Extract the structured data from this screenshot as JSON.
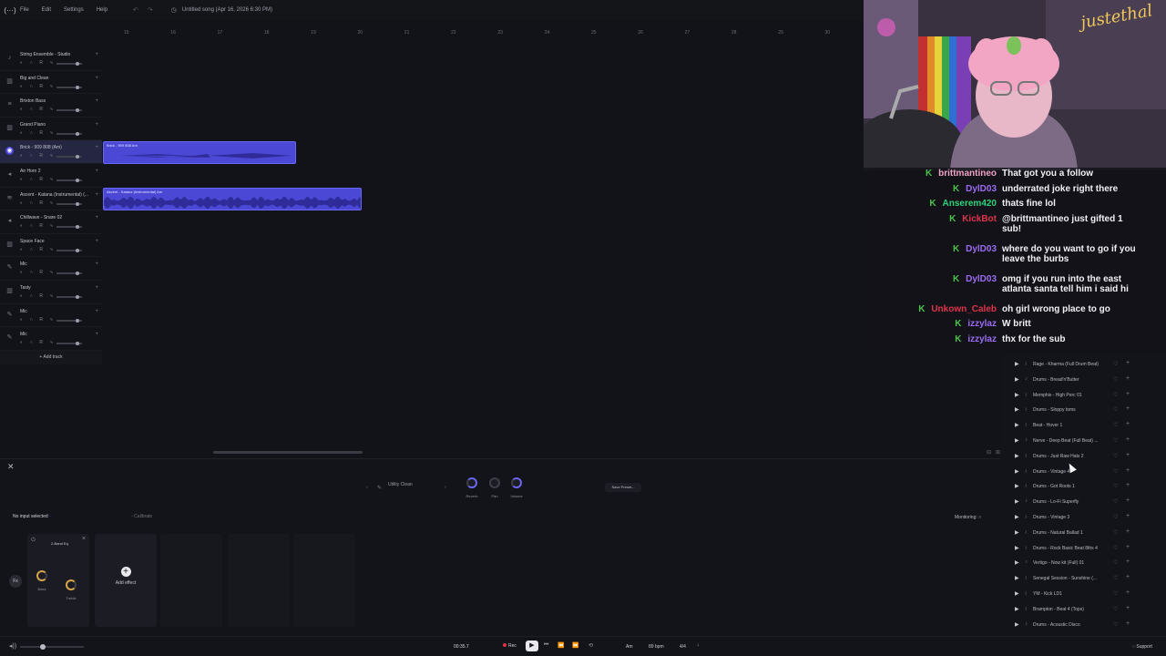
{
  "menubar": {
    "logo_icon": "app-logo-icon",
    "items": [
      "File",
      "Edit",
      "Settings",
      "Help"
    ],
    "undo_glyph": "↶",
    "redo_glyph": "↷",
    "project_title": "Untitled song (Apr 16, 2026 6:30 PM)"
  },
  "ruler": [
    "15",
    "16",
    "17",
    "18",
    "19",
    "20",
    "21",
    "22",
    "23",
    "24",
    "25",
    "26",
    "27",
    "28",
    "29",
    "30"
  ],
  "tracks": [
    {
      "name": "String Ensemble - Studio",
      "icon": "♪",
      "selected": false
    },
    {
      "name": "Big and Clean",
      "icon": "▥",
      "selected": false
    },
    {
      "name": "Brixton Bass",
      "icon": "≡",
      "selected": false
    },
    {
      "name": "Grand Piano",
      "icon": "▥",
      "selected": false
    },
    {
      "name": "Brick - 909 808 (Am)",
      "icon": "◉",
      "selected": true
    },
    {
      "name": "Air Horn 2",
      "icon": "◂",
      "selected": false
    },
    {
      "name": "Ascent - Katana (Instrumental) (...",
      "icon": "≋",
      "selected": false
    },
    {
      "name": "Chillwave - Snare 02",
      "icon": "◂",
      "selected": false
    },
    {
      "name": "Space Face",
      "icon": "▥",
      "selected": false
    },
    {
      "name": "Mic",
      "icon": "✎",
      "selected": false
    },
    {
      "name": "Tasty",
      "icon": "▥",
      "selected": false
    },
    {
      "name": "Mic",
      "icon": "✎",
      "selected": false
    },
    {
      "name": "Mic",
      "icon": "✎",
      "selected": false
    }
  ],
  "track_controls": "◐ ∩ R ∿",
  "track_plus": "+",
  "add_track": "+ Add track",
  "clips": [
    {
      "name": "Brick - 909 808 Am"
    },
    {
      "name": "Ascent - Katana (Instrumental) Am"
    }
  ],
  "bottom": {
    "close": "✕",
    "instrument_name": "Utility Clean",
    "instrument_prev": "‹",
    "instrument_next": "›",
    "knobs": [
      "Reverb",
      "Pan",
      "Volume"
    ],
    "save_preset": "Save Preset...",
    "no_input": "No input selected",
    "calibrate": "Calibrate",
    "monitoring": "Monitoring:",
    "fx_name": "2-Band Eq",
    "fx_knobs": [
      "Bass",
      "Treble"
    ],
    "fx_toggle": "Fx",
    "add_effect": "Add effect"
  },
  "transport": {
    "time": "00:35.7",
    "rec": "Rec",
    "key": "Am",
    "bpm": "89 bpm",
    "signature": "4/4",
    "support": "Support",
    "buttons": [
      "⏮",
      "⏪",
      "⏩",
      "⟲"
    ]
  },
  "webcam_overlay": "justethal",
  "chat": [
    {
      "user": "brittmantineo",
      "color": "#f2a3c9",
      "text": "That got you a follow",
      "cont": ""
    },
    {
      "user": "DylD03",
      "color": "#9b6cf2",
      "text": "underrated joke right there",
      "cont": ""
    },
    {
      "user": "Anserem420",
      "color": "#2fd27a",
      "text": "thats fine lol",
      "cont": ""
    },
    {
      "user": "KickBot",
      "color": "#e0334a",
      "text": "@brittmantineo just gifted 1",
      "cont": "sub!"
    },
    {
      "user": "DylD03",
      "color": "#9b6cf2",
      "text": "where do you want to go if you",
      "cont": "leave the burbs"
    },
    {
      "user": "DylD03",
      "color": "#9b6cf2",
      "text": "omg if you run into the east",
      "cont": "atlanta santa tell him i said hi"
    },
    {
      "user": "Unkown_Caleb",
      "color": "#e0334a",
      "text": "oh girl wrong place to go",
      "cont": ""
    },
    {
      "user": "izzylaz",
      "color": "#9b6cf2",
      "text": "W britt",
      "cont": ""
    },
    {
      "user": "izzylaz",
      "color": "#9b6cf2",
      "text": "thx for the sub",
      "cont": ""
    }
  ],
  "loops": [
    "Rage - Kharma (Full Drum Beat)",
    "Drums - Bread'n'Butter",
    "Memphis - High Perc 01",
    "Drums - Sloppy toms",
    "Beat - Hover 1",
    "Nerve - Deep Beat (Full Beat) ...",
    "Drums - Just Raw Hats 2",
    "Drums - Vintage 4",
    "Drums - Got Roots 1",
    "Drums - Lo-Fi Superfly",
    "Drums - Vintage 3",
    "Drums - Natural Ballad 1",
    "Drums - Rock Basic Beat 8ths 4",
    "Vertigo - Now kit (Full) 01",
    "Senegal Session - Sunshine (...",
    "YM - Kick LD1",
    "Brampton - Beat 4 (Tops)",
    "Drums - Acoustic Disco"
  ],
  "colors": {
    "accent": "#4b48d6",
    "background": "#121318",
    "panel": "#131419",
    "record": "#e0334a",
    "knob_gold": "#d9a548"
  }
}
